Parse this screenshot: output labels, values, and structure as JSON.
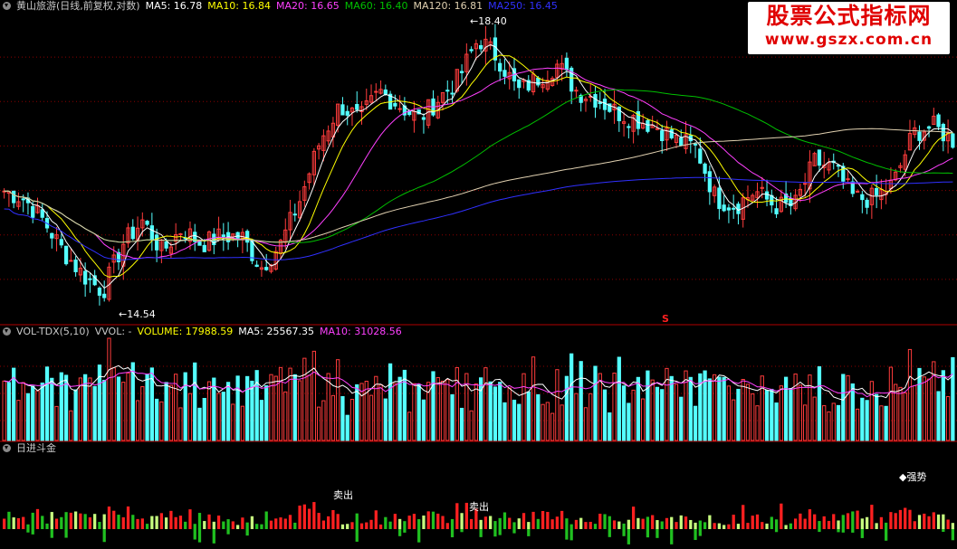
{
  "header_main": {
    "stock": "黄山旅游(日线,前复权,对数)",
    "ma5": "MA5: 16.78",
    "ma10": "MA10: 16.84",
    "ma20": "MA20: 16.65",
    "ma60": "MA60: 16.40",
    "ma120": "MA120: 16.81",
    "ma250": "MA250: 16.45"
  },
  "header_vol": {
    "name": "VOL-TDX(5,10)",
    "vvol": "VVOL: -",
    "volume": "VOLUME: 17988.59",
    "ma5": "MA5: 25567.35",
    "ma10": "MA10: 31028.56"
  },
  "header_ind": {
    "name": "日进斗金"
  },
  "watermark": {
    "line1": "股票公式指标网",
    "line2": "www.gszx.com.cn"
  },
  "annotations": {
    "high": "18.40",
    "low": "14.54",
    "sell1": "卖出",
    "sell2": "卖出",
    "strong": "◆强势",
    "s_marker": "S"
  },
  "colors": {
    "up": "#ff3c3c",
    "down": "#54ffff",
    "ma5": "#ffffff",
    "ma10": "#ffff00",
    "ma20": "#ff40ff",
    "ma60": "#00c000",
    "ma120": "#e0d0b0",
    "ma250": "#3030ff",
    "grid": "#8b0000"
  },
  "chart_data": [
    {
      "type": "candlestick",
      "title": "黄山旅游(日线,前复权,对数)",
      "ylim": [
        14.3,
        18.6
      ],
      "annotated_high": 18.4,
      "annotated_low": 14.54,
      "moving_averages": {
        "MA5": 16.78,
        "MA10": 16.84,
        "MA20": 16.65,
        "MA60": 16.4,
        "MA120": 16.81,
        "MA250": 16.45
      },
      "close_path": [
        16.0,
        15.9,
        15.6,
        15.2,
        14.9,
        14.7,
        15.3,
        15.6,
        15.2,
        15.5,
        15.3,
        15.4,
        15.4,
        15.0,
        15.3,
        15.9,
        16.7,
        17.2,
        17.0,
        17.4,
        17.2,
        17.0,
        17.3,
        17.6,
        18.2,
        17.9,
        17.4,
        17.6,
        17.8,
        17.4,
        17.3,
        17.1,
        17.0,
        16.9,
        16.7,
        16.6,
        15.9,
        15.8,
        16.0,
        15.8,
        15.8,
        16.4,
        16.3,
        15.9,
        15.9,
        16.1,
        16.8,
        16.9,
        16.7
      ]
    },
    {
      "type": "bar",
      "title": "VOL-TDX(5,10)",
      "volume": 17988.59,
      "MA5": 25567.35,
      "MA10": 31028.56
    },
    {
      "type": "bar",
      "title": "日进斗金",
      "signals": [
        "卖出",
        "卖出",
        "◆强势"
      ]
    }
  ]
}
